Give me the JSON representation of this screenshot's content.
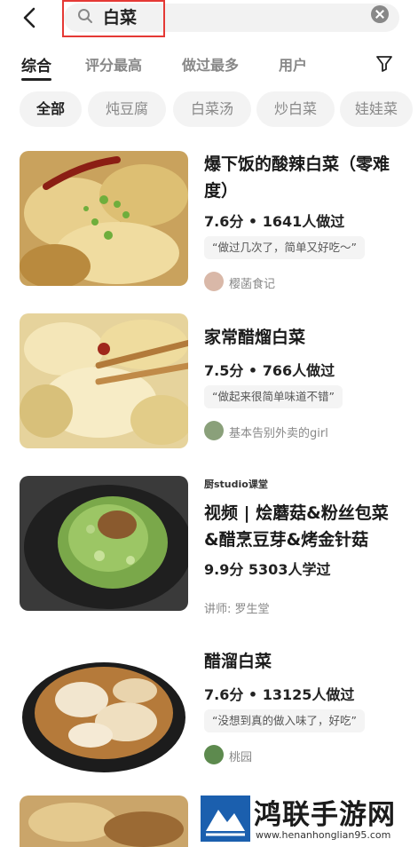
{
  "search": {
    "query": "白菜"
  },
  "tabs": [
    {
      "label": "综合"
    },
    {
      "label": "评分最高"
    },
    {
      "label": "做过最多"
    },
    {
      "label": "用户"
    }
  ],
  "chips": [
    {
      "label": "全部"
    },
    {
      "label": "炖豆腐"
    },
    {
      "label": "白菜汤"
    },
    {
      "label": "炒白菜"
    },
    {
      "label": "娃娃菜"
    }
  ],
  "recipes": [
    {
      "title": "爆下饭的酸辣白菜（零难度）",
      "stats": "7.6分 • 1641人做过",
      "quote": "“做过几次了，简单又好吃～”",
      "author": "樱菡食记"
    },
    {
      "title": "家常醋熘白菜",
      "stats": "7.5分 • 766人做过",
      "quote": "“做起来很简单味道不错”",
      "author": "基本告别外卖的girl"
    },
    {
      "subtitle": "厨studio课堂",
      "title": "视频 | 烩蘑菇&粉丝包菜&醋烹豆芽&烤金针菇",
      "stats": "9.9分 5303人学过",
      "author": "讲师: 罗生堂"
    },
    {
      "title": "醋溜白菜",
      "stats": "7.6分 • 13125人做过",
      "quote": "“没想到真的做入味了，好吃”",
      "author": "桃园"
    }
  ],
  "watermark": {
    "title": "鸿联手游网",
    "url": "www.henanhonglian95.com"
  },
  "colors": {
    "highlight": "#e53935",
    "chip_bg": "#f3f3f3",
    "text_muted": "#888888"
  }
}
